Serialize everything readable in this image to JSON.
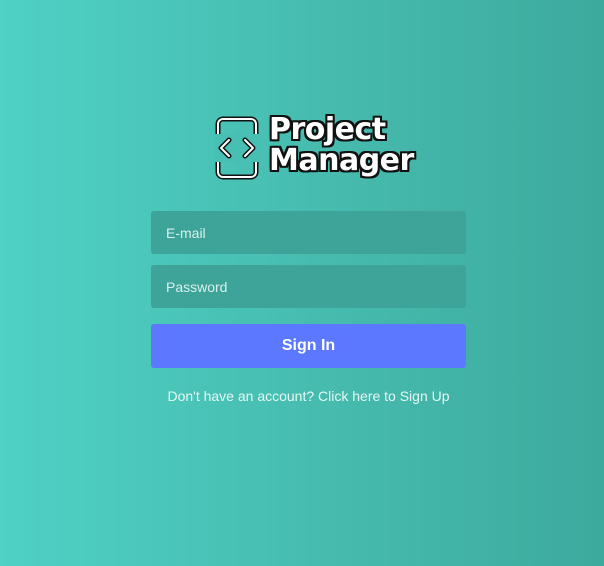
{
  "logo": {
    "line1": "Project",
    "line2": "Manager",
    "icon": "code-device-icon"
  },
  "form": {
    "email_placeholder": "E-mail",
    "password_placeholder": "Password",
    "signin_label": "Sign In",
    "signup_link": "Don't have an account? Click here to Sign Up"
  },
  "colors": {
    "background_start": "#4fd1c5",
    "background_end": "#3daa9e",
    "input_bg": "#3ea398",
    "button_bg": "#5b78ff"
  }
}
